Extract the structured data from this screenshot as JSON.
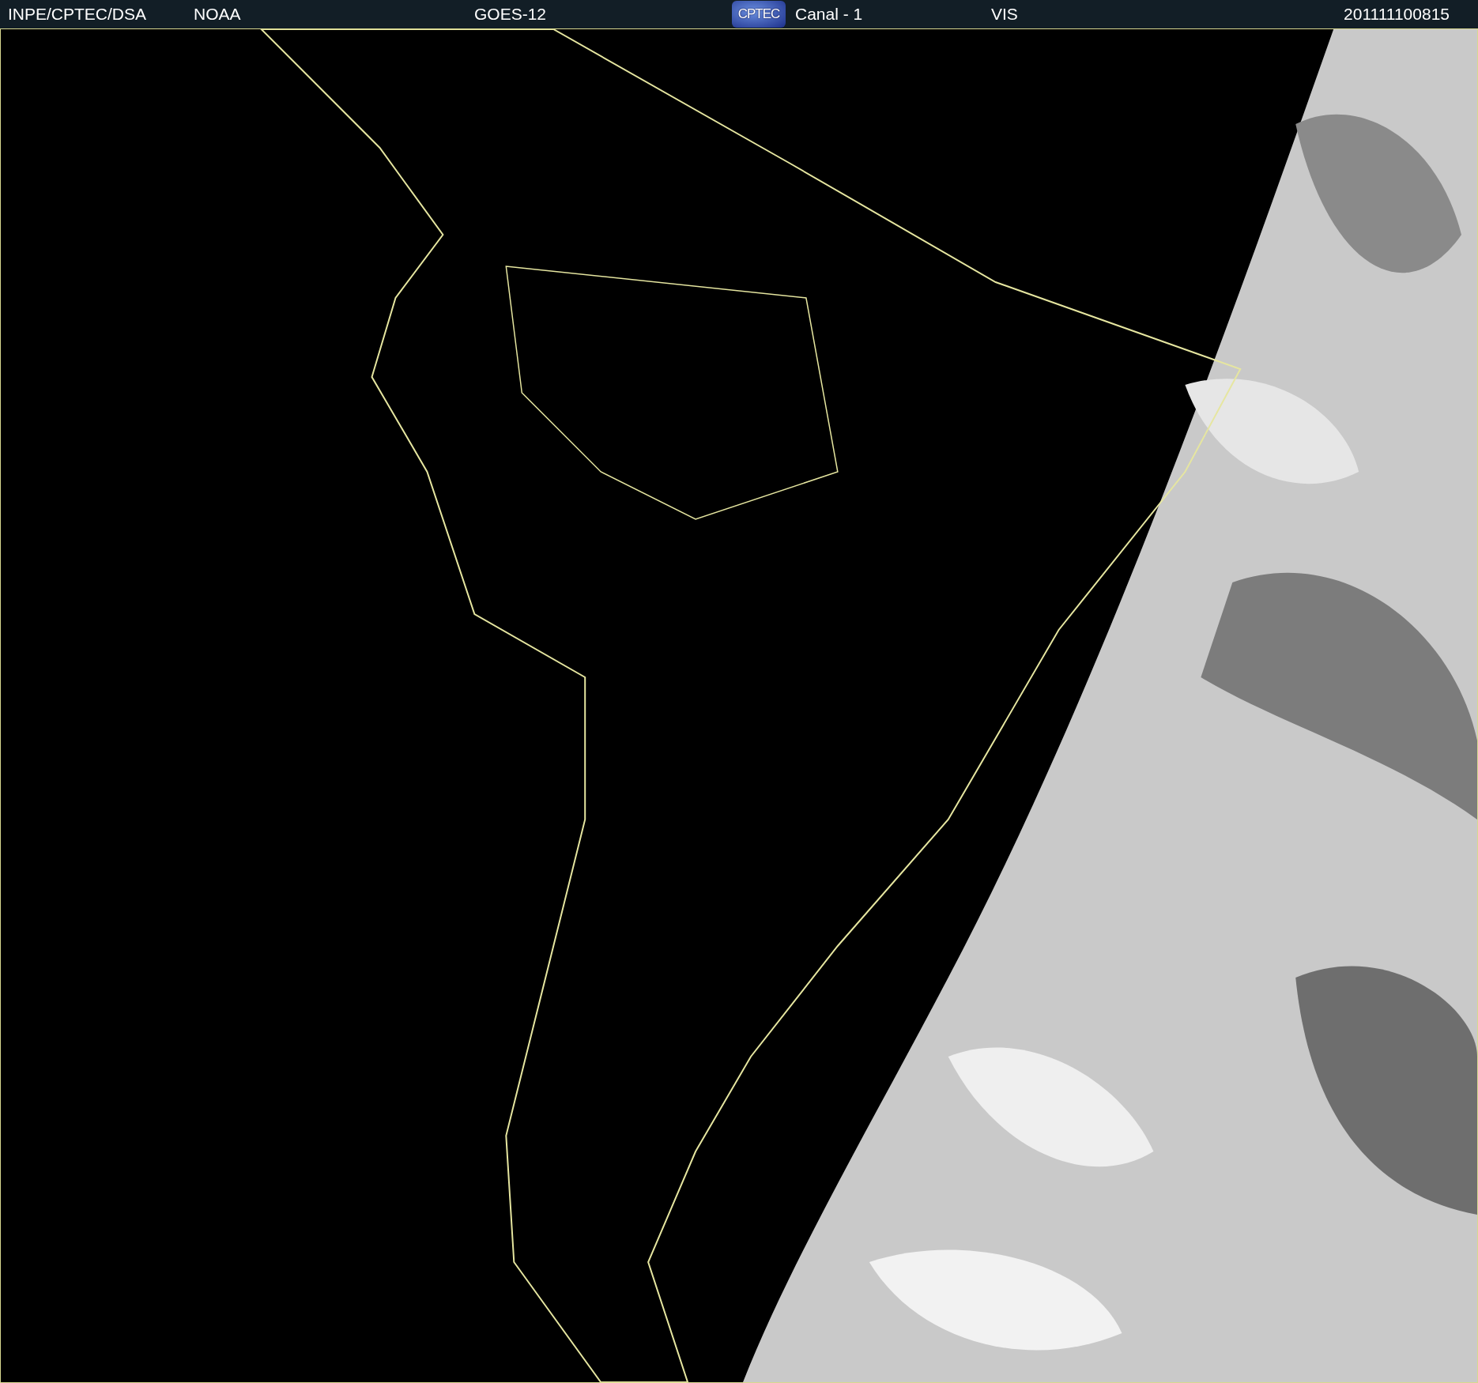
{
  "header": {
    "source": "INPE/CPTEC/DSA",
    "agency": "NOAA",
    "satellite": "GOES-12",
    "logo": "CPTEC",
    "channel": "Canal - 1",
    "band": "VIS",
    "timestamp": "201111100815"
  }
}
